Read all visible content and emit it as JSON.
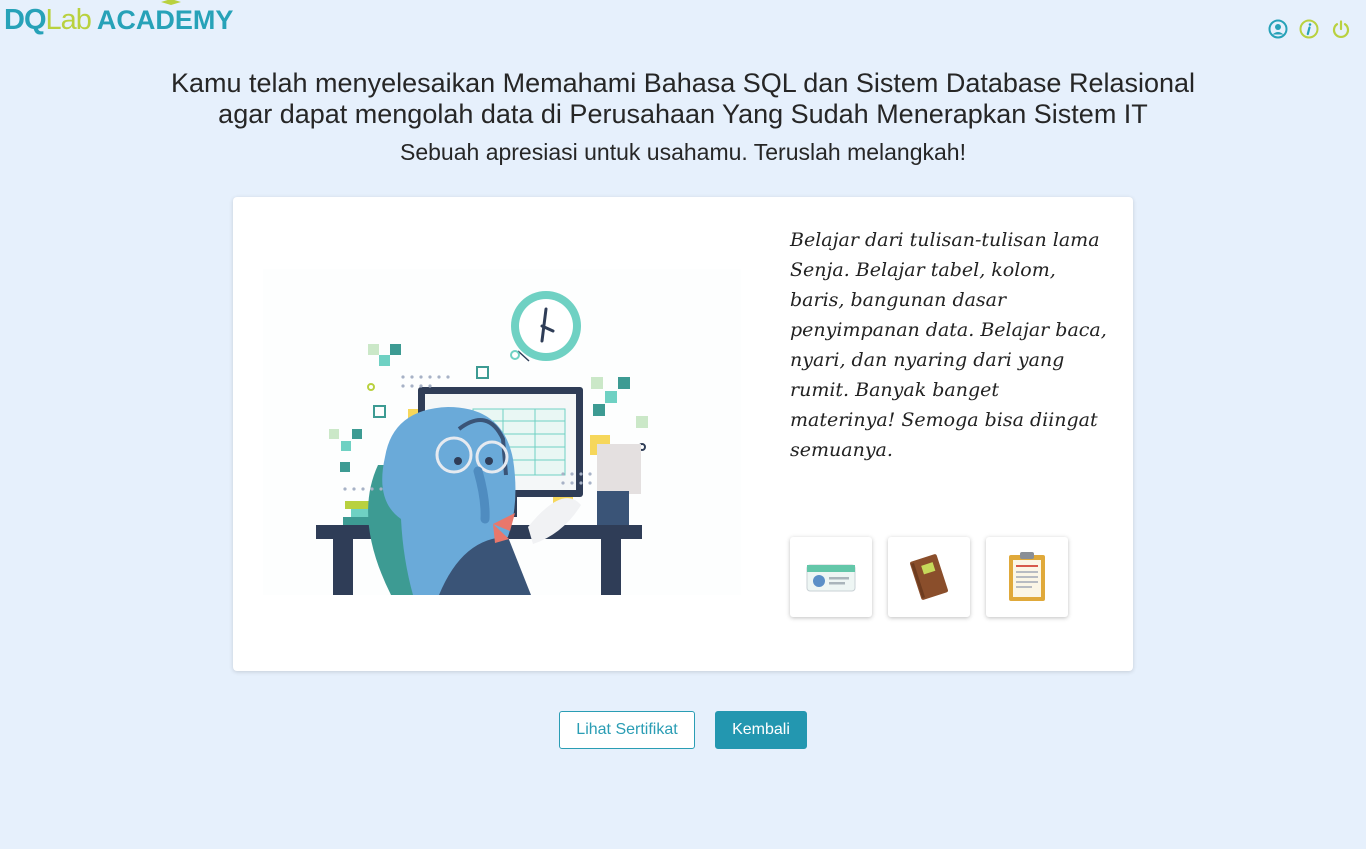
{
  "brand": {
    "part1": "DQ",
    "part2": "Lab",
    "part3": "ACADEMY"
  },
  "header_icons": [
    "user-icon",
    "info-icon",
    "power-icon"
  ],
  "headline": {
    "line1": "Kamu telah menyelesaikan Memahami Bahasa SQL dan Sistem Database Relasional",
    "line2": "agar dapat mengolah data di Perusahaan Yang Sudah Menerapkan Sistem IT",
    "subtitle": "Sebuah apresiasi untuk usahamu. Teruslah melangkah!"
  },
  "card": {
    "quote_lines": [
      "Belajar dari tulisan-tulisan lama",
      "Senja. Belajar tabel, kolom,",
      "baris, bangunan dasar",
      "penyimpanan data. Belajar baca,",
      "nyari, dan nyaring dari yang",
      "rumit. Banyak banget",
      "materinya! Semoga bisa diingat",
      "semuanya."
    ],
    "reward_tiles": [
      "id-card-icon",
      "book-icon",
      "clipboard-icon"
    ]
  },
  "buttons": {
    "certificate": "Lihat Sertifikat",
    "back": "Kembali"
  },
  "colors": {
    "background": "#e6f0fc",
    "accent": "#2397b0",
    "brand_green": "#b9d13f"
  }
}
